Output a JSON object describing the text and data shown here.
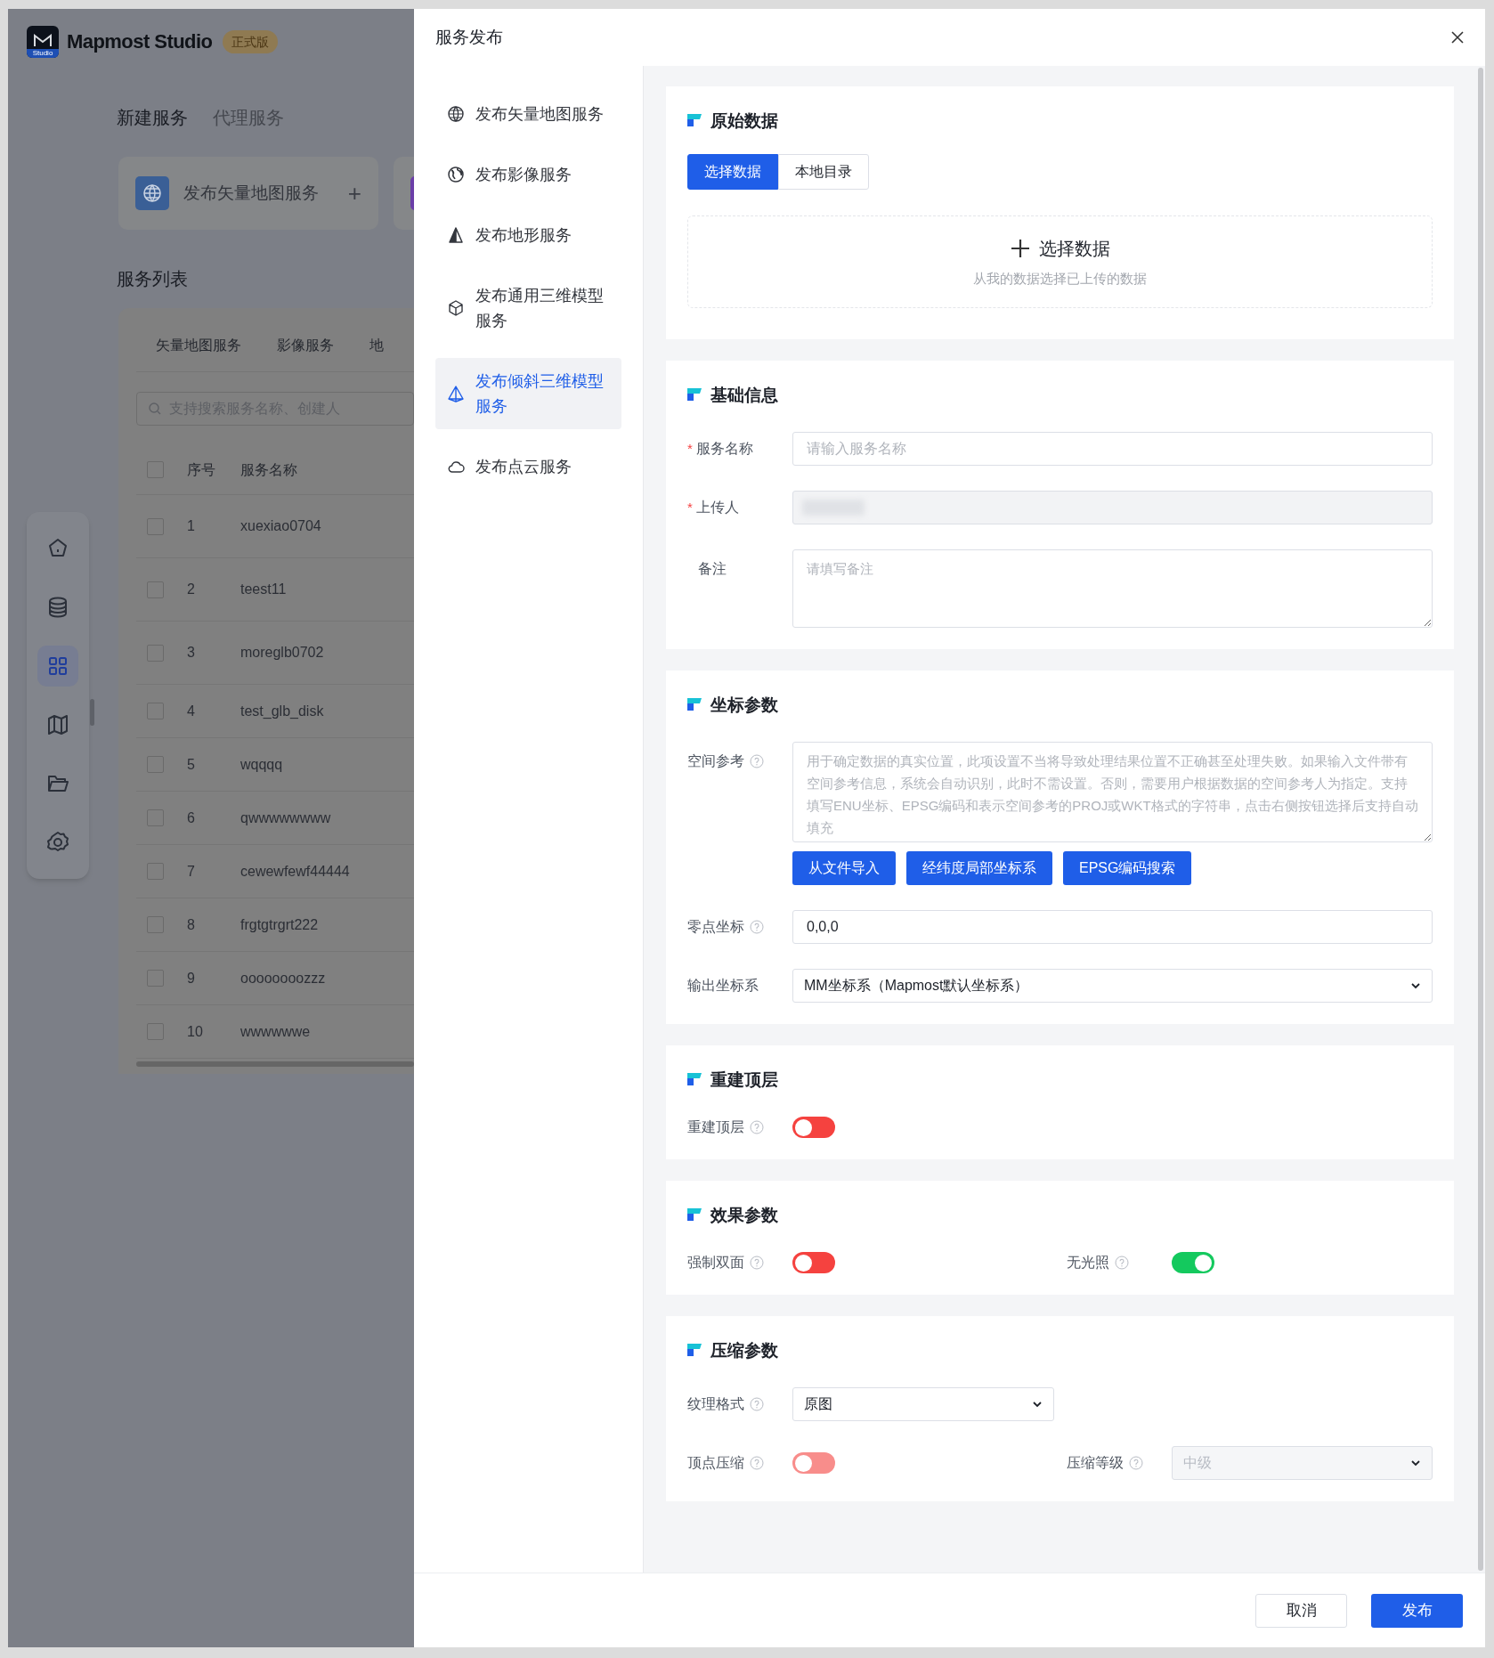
{
  "app": {
    "logo_caption": "Studio",
    "brand": "Mapmost Studio",
    "edition_badge": "正式版",
    "nav_rail": [
      {
        "kind": "home",
        "selected": false
      },
      {
        "kind": "database",
        "selected": false
      },
      {
        "kind": "apps",
        "selected": true
      },
      {
        "kind": "map",
        "selected": false
      },
      {
        "kind": "folder",
        "selected": false
      },
      {
        "kind": "settings",
        "selected": false
      }
    ],
    "page_tabs": [
      {
        "label": "新建服务",
        "selected": true
      },
      {
        "label": "代理服务",
        "selected": false
      }
    ],
    "service_cards": [
      {
        "label": "发布矢量地图服务",
        "action": "+"
      }
    ],
    "list_title": "服务列表",
    "list_tabs": [
      {
        "label": "矢量地图服务"
      },
      {
        "label": "影像服务"
      },
      {
        "label": "地"
      }
    ],
    "search": {
      "placeholder": "支持搜索服务名称、创建人"
    },
    "table": {
      "checked": false,
      "columns": [
        "序号",
        "服务名称"
      ],
      "rows": [
        {
          "index": "1",
          "name": "xuexiao0704",
          "checked": false
        },
        {
          "index": "2",
          "name": "teest11",
          "checked": false
        },
        {
          "index": "3",
          "name": "moreglb0702",
          "checked": false
        },
        {
          "index": "4",
          "name": "test_glb_disk",
          "checked": false
        },
        {
          "index": "5",
          "name": "wqqqq",
          "checked": false
        },
        {
          "index": "6",
          "name": "qwwwwwwww",
          "checked": false
        },
        {
          "index": "7",
          "name": "cewewfewf44444",
          "checked": false
        },
        {
          "index": "8",
          "name": "frgtgtrgrt222",
          "checked": false
        },
        {
          "index": "9",
          "name": "oooooooozzz",
          "checked": false
        },
        {
          "index": "10",
          "name": "wwwwwwe",
          "checked": false
        }
      ]
    }
  },
  "dialog": {
    "title": "服务发布",
    "menu": [
      {
        "kind": "globe",
        "label": "发布矢量地图服务",
        "selected": false
      },
      {
        "kind": "earth",
        "label": "发布影像服务",
        "selected": false
      },
      {
        "kind": "terrain",
        "label": "发布地形服务",
        "selected": false
      },
      {
        "kind": "cube",
        "label": "发布通用三维模型服务",
        "selected": false
      },
      {
        "kind": "pyramid",
        "label": "发布倾斜三维模型服务",
        "selected": true
      },
      {
        "kind": "cloud",
        "label": "发布点云服务",
        "selected": false
      }
    ],
    "sections": [
      {
        "title": "原始数据",
        "source_tabs": [
          {
            "label": "选择数据",
            "selected": true
          },
          {
            "label": "本地目录",
            "selected": false
          }
        ],
        "dropzone": {
          "action": "选择数据",
          "hint": "从我的数据选择已上传的数据"
        }
      },
      {
        "title": "基础信息",
        "rows": [
          [
            {
              "kind": "input",
              "label": "服务名称",
              "required_mark": "*",
              "placeholder": "请输入服务名称"
            }
          ],
          [
            {
              "kind": "input",
              "label": "上传人",
              "required_mark": "*",
              "disabled": true
            }
          ],
          [
            {
              "kind": "textarea",
              "label": "备注",
              "placeholder": "请填写备注"
            }
          ]
        ]
      },
      {
        "title": "坐标参数",
        "rows": [
          [
            {
              "kind": "textarea",
              "label": "空间参考",
              "help": true,
              "placeholder": "用于确定数据的真实位置，此项设置不当将导致处理结果位置不正确甚至处理失败。如果输入文件带有空间参考信息，系统会自动识别，此时不需设置。否则，需要用户根据数据的空间参考人为指定。支持填写ENU坐标、EPSG编码和表示空间参考的PROJ或WKT格式的字符串，点击右侧按钮选择后支持自动填充",
              "buttons": [
                "从文件导入",
                "经纬度局部坐标系",
                "EPSG编码搜索"
              ]
            }
          ],
          [
            {
              "kind": "input",
              "label": "零点坐标",
              "help": true,
              "value": "0,0,0"
            }
          ],
          [
            {
              "kind": "select",
              "label": "输出坐标系",
              "value": "MM坐标系（Mapmost默认坐标系）"
            }
          ]
        ]
      },
      {
        "title": "重建顶层",
        "rows": [
          [
            {
              "kind": "switch",
              "label": "重建顶层",
              "help": true,
              "on": false
            }
          ]
        ]
      },
      {
        "title": "效果参数",
        "rows": [
          [
            {
              "kind": "switch",
              "label": "强制双面",
              "help": true,
              "on": false
            },
            {
              "kind": "switch",
              "label": "无光照",
              "help": true,
              "on": true
            }
          ]
        ]
      },
      {
        "title": "压缩参数",
        "rows": [
          [
            {
              "kind": "select",
              "label": "纹理格式",
              "help": true,
              "value": "原图"
            }
          ],
          [
            {
              "kind": "switch",
              "label": "顶点压缩",
              "help": true,
              "on": false,
              "disabled": true
            },
            {
              "kind": "select",
              "label": "压缩等级",
              "help": true,
              "value": "中级",
              "disabled": true
            }
          ]
        ]
      }
    ],
    "footer": {
      "cancel": "取消",
      "submit": "发布"
    }
  }
}
